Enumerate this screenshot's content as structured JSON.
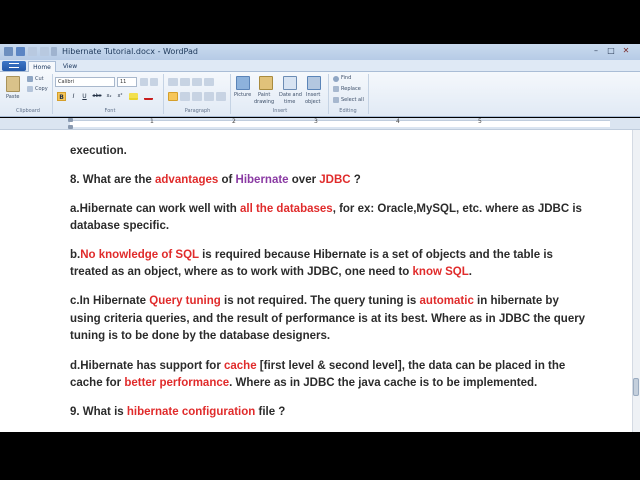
{
  "window": {
    "title": "Hibernate Tutorial.docx - WordPad",
    "controls": [
      "–",
      "□",
      "✕"
    ]
  },
  "ribbon": {
    "file_label": "",
    "tabs": [
      {
        "label": "Home"
      },
      {
        "label": "View"
      }
    ],
    "clipboard": {
      "paste": "Paste",
      "cut": "Cut",
      "copy": "Copy",
      "group": "Clipboard"
    },
    "font": {
      "family": "Calibri",
      "size": "11",
      "group": "Font",
      "bold": "B",
      "italic": "I",
      "underline": "U",
      "strike": "abc",
      "subscript": "x₂",
      "superscript": "x²"
    },
    "paragraph": {
      "group": "Paragraph"
    },
    "insert": {
      "picture": "Picture",
      "paint": "Paint\ndrawing",
      "paint_line1": "Paint",
      "paint_line2": "drawing",
      "datetime_line1": "Date and",
      "datetime_line2": "time",
      "object_line1": "Insert",
      "object_line2": "object",
      "group": "Insert"
    },
    "editing": {
      "find": "Find",
      "replace": "Replace",
      "select_all": "Select all",
      "group": "Editing"
    }
  },
  "ruler": {
    "numbers": [
      "1",
      "2",
      "3",
      "4",
      "5"
    ]
  },
  "document": {
    "l1": {
      "a": "execution."
    },
    "l2": {
      "a": "8. What are the ",
      "b": "advantages",
      "c": " of ",
      "d": "Hibernate",
      "e": " over ",
      "f": "JDBC",
      "g": " ?"
    },
    "l3": {
      "a": "a.Hibernate can work well with ",
      "b": "all the databases",
      "c": ", for ex: Oracle,MySQL, etc. where as JDBC is"
    },
    "l4": {
      "a": "database specific."
    },
    "l5": {
      "a": "b.",
      "b": "No knowledge of SQL",
      "c": " is required because Hibernate is a set of objects and the table is"
    },
    "l6": {
      "a": "treated as an object, where as to work with JDBC, one need to ",
      "b": "know SQL",
      "c": "."
    },
    "l7": {
      "a": "c.In Hibernate ",
      "b": "Query tuning",
      "c": " is not required. The query tuning is ",
      "d": "automatic",
      "e": " in hibernate by"
    },
    "l8": {
      "a": "using criteria queries, and the result of performance is at its best. Where as in JDBC the query"
    },
    "l9": {
      "a": "tuning is to be done by the database designers."
    },
    "l10": {
      "a": "d.Hibernate has support for ",
      "b": "cache",
      "c": " [first level & second level], the data can be placed in the"
    },
    "l11": {
      "a": "cache for ",
      "b": "better performance",
      "c": ". Where as in JDBC the java cache is to be implemented."
    },
    "l12": {
      "a": "9. What is ",
      "b": "hibernate configuration",
      "c": " file ?"
    }
  },
  "colors": {
    "accent_red": "#e02b2b",
    "accent_purple": "#8a3aa3",
    "text": "#2b2b2b"
  }
}
